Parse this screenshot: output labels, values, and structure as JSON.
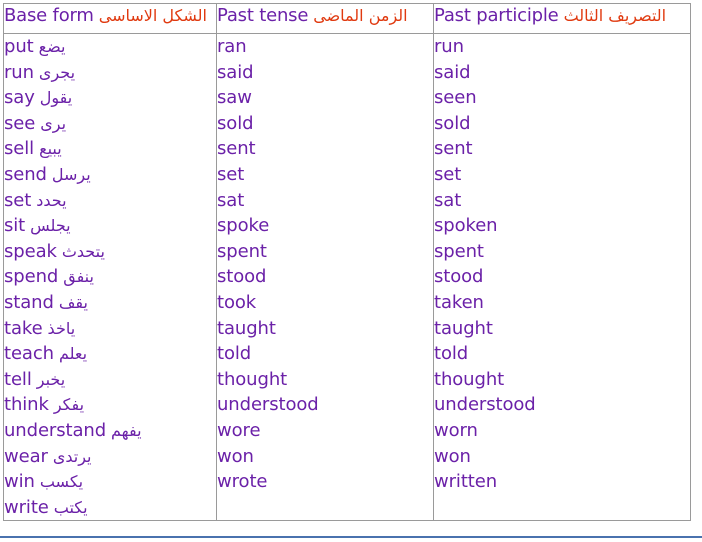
{
  "page": {
    "title": "Irregular Verbs Table",
    "accent_purple": "#6B21A8",
    "accent_red": "#E03A10",
    "border_color": "#9A9A9A",
    "rule_color": "#4A72AE"
  },
  "table": {
    "columns": [
      {
        "english": "Base form",
        "arabic": "الشكل الاساسى"
      },
      {
        "english": "Past tense",
        "arabic": "الزمن الماضى"
      },
      {
        "english": "Past participle",
        "arabic": "التصريف الثالث"
      }
    ],
    "base_form": [
      {
        "english": "put",
        "arabic": "يضع"
      },
      {
        "english": "run",
        "arabic": "يجرى"
      },
      {
        "english": "say",
        "arabic": "يقول"
      },
      {
        "english": "see",
        "arabic": "يرى"
      },
      {
        "english": "sell",
        "arabic": "يبيع"
      },
      {
        "english": "send",
        "arabic": "يرسل"
      },
      {
        "english": "set",
        "arabic": "يحدد"
      },
      {
        "english": "sit",
        "arabic": "يجلس"
      },
      {
        "english": "speak",
        "arabic": "يتحدث"
      },
      {
        "english": "spend",
        "arabic": "ينفق"
      },
      {
        "english": "stand",
        "arabic": "يقف"
      },
      {
        "english": "take",
        "arabic": "ياخذ"
      },
      {
        "english": "teach",
        "arabic": "يعلم"
      },
      {
        "english": "tell",
        "arabic": "يخبر"
      },
      {
        "english": "think",
        "arabic": "يفكر"
      },
      {
        "english": "understand",
        "arabic": "يفهم"
      },
      {
        "english": "wear",
        "arabic": "يرتدى"
      },
      {
        "english": "win",
        "arabic": "يكسب"
      },
      {
        "english": "write",
        "arabic": "يكتب"
      }
    ],
    "past_tense": [
      "ran",
      "said",
      "saw",
      "sold",
      "sent",
      "set",
      "sat",
      "spoke",
      "spent",
      "stood",
      "took",
      "taught",
      "told",
      "thought",
      "understood",
      "wore",
      "won",
      "wrote"
    ],
    "past_participle": [
      "run",
      "said",
      "seen",
      "sold",
      "sent",
      "set",
      "sat",
      "spoken",
      "spent",
      "stood",
      "taken",
      "taught",
      "told",
      "thought",
      "understood",
      "worn",
      "won",
      "written"
    ]
  }
}
